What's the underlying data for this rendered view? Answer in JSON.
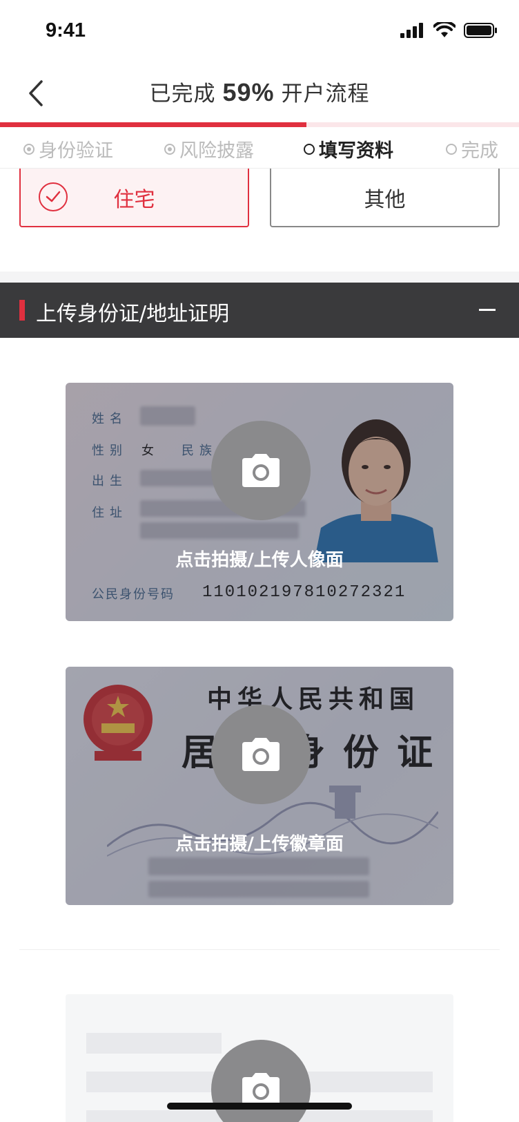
{
  "status_bar": {
    "time": "9:41"
  },
  "header": {
    "prefix": "已完成",
    "percent": "59%",
    "suffix": "开户流程",
    "progress_fraction": 0.59
  },
  "steps": [
    {
      "label": "身份验证",
      "state": "done"
    },
    {
      "label": "风险披露",
      "state": "done"
    },
    {
      "label": "填写资料",
      "state": "active"
    },
    {
      "label": "完成",
      "state": "pending"
    }
  ],
  "residence_options": [
    {
      "label": "住宅",
      "selected": true
    },
    {
      "label": "其他",
      "selected": false
    }
  ],
  "section": {
    "title": "上传身份证/地址证明"
  },
  "id_front": {
    "labels": [
      "姓名",
      "性别",
      "民族",
      "出生",
      "住址",
      "公民身份号码"
    ],
    "gender": "女",
    "id_number": "110102197810272321",
    "upload_label": "点击拍摄/上传人像面"
  },
  "id_back": {
    "title": "中华人民共和国",
    "big_title": "居民身份证",
    "upload_label": "点击拍摄/上传徽章面"
  },
  "colors": {
    "accent": "#e0303f",
    "header_bg": "#3a3a3c",
    "selected_bg": "#fdf2f3"
  }
}
